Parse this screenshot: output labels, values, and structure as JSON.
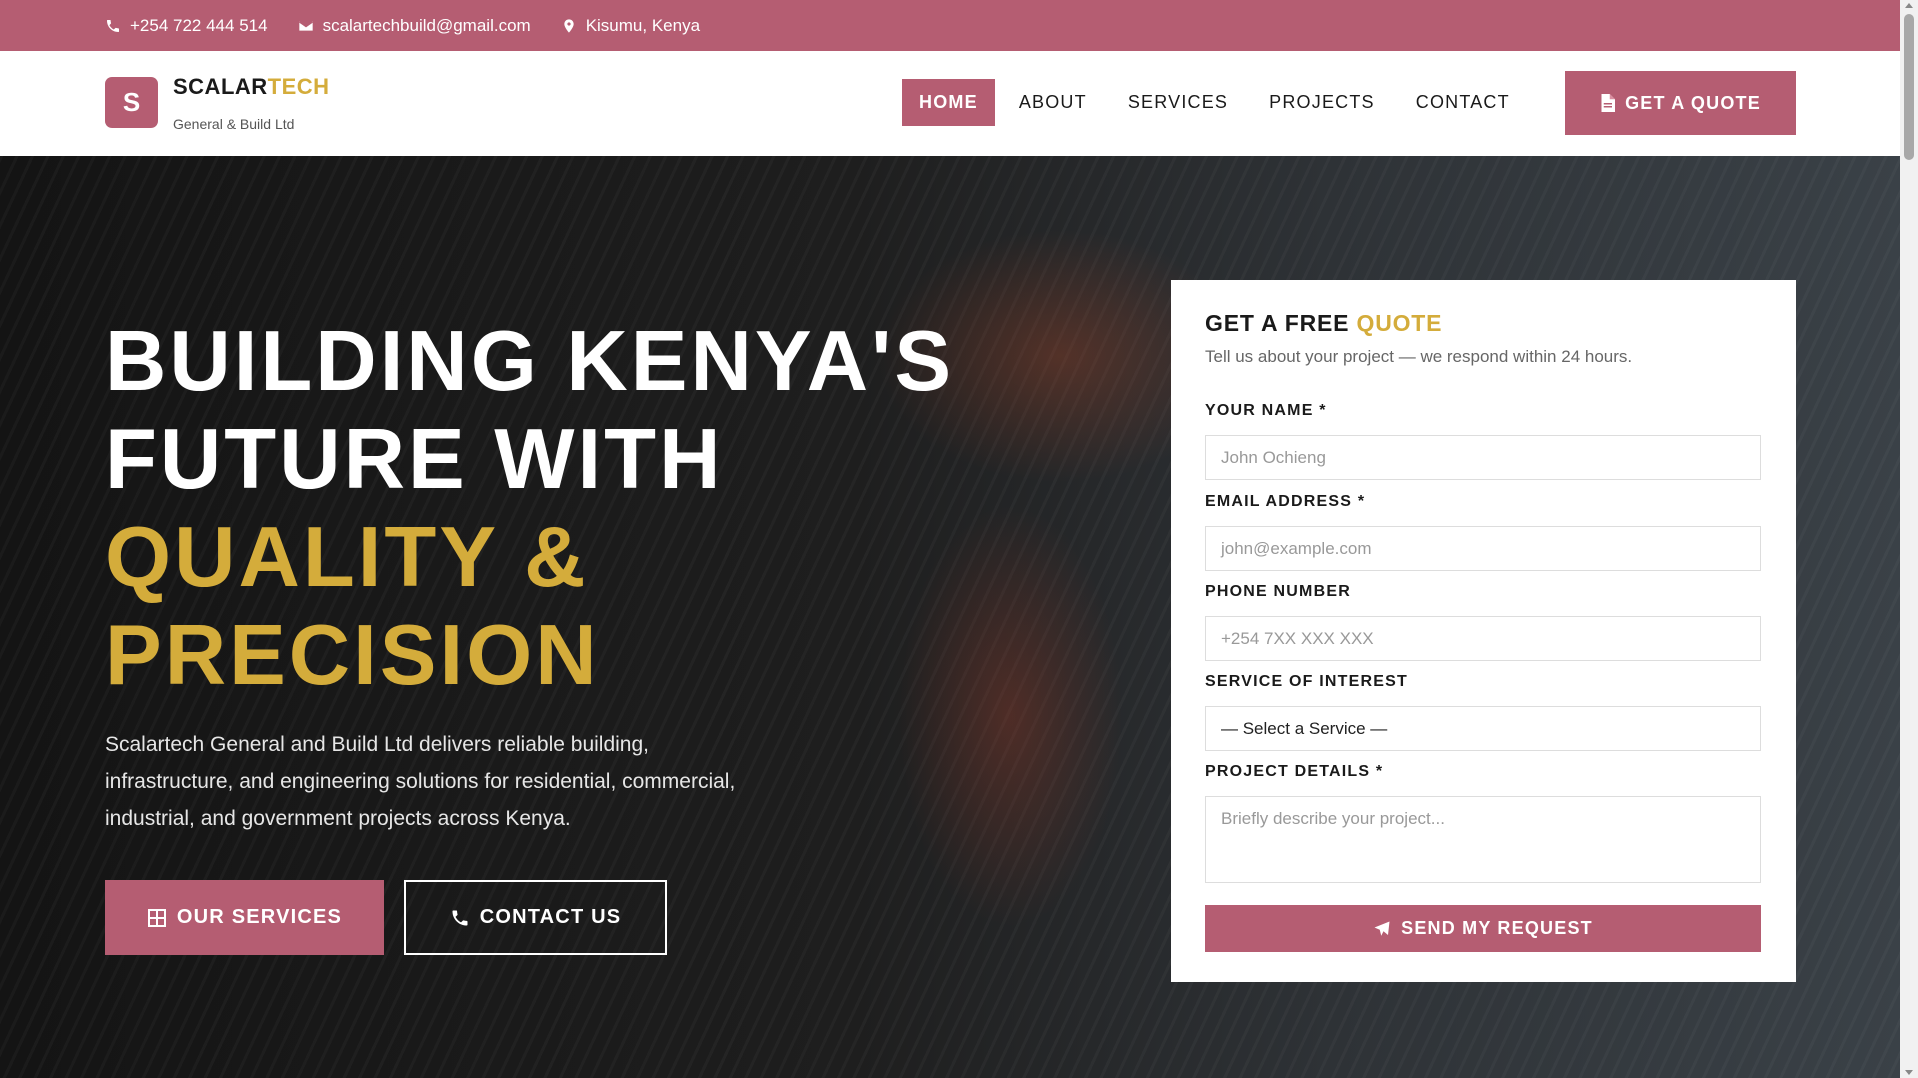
{
  "topbar": {
    "phone": "+254 722 444 514",
    "email": "scalartechbuild@gmail.com",
    "location": "Kisumu, Kenya"
  },
  "brand": {
    "logo_letter": "S",
    "name_part1": "SCALAR",
    "name_part2": "TECH",
    "tagline": "General & Build Ltd"
  },
  "nav": {
    "items": [
      {
        "label": "HOME",
        "active": true
      },
      {
        "label": "ABOUT"
      },
      {
        "label": "SERVICES"
      },
      {
        "label": "PROJECTS"
      },
      {
        "label": "CONTACT"
      }
    ],
    "quote_label": "GET A QUOTE"
  },
  "hero": {
    "title_line1": "BUILDING KENYA'S",
    "title_line2": "FUTURE WITH",
    "title_line3": "QUALITY &",
    "title_line4": "PRECISION",
    "description": "Scalartech General and Build Ltd delivers reliable building, infrastructure, and engineering solutions for residential, commercial, industrial, and government projects across Kenya.",
    "btn_services": "OUR SERVICES",
    "btn_contact": "CONTACT US"
  },
  "form": {
    "title_part1": "GET A FREE ",
    "title_part2": "QUOTE",
    "subtitle": "Tell us about your project — we respond within 24 hours.",
    "name_label": "YOUR NAME *",
    "name_placeholder": "John Ochieng",
    "email_label": "EMAIL ADDRESS *",
    "email_placeholder": "john@example.com",
    "phone_label": "PHONE NUMBER",
    "phone_placeholder": "+254 7XX XXX XXX",
    "service_label": "SERVICE OF INTEREST",
    "service_selected": "— Select a Service —",
    "details_label": "PROJECT DETAILS *",
    "details_placeholder": "Briefly describe your project...",
    "submit_label": "SEND MY REQUEST"
  },
  "colors": {
    "brand": "#b55d72",
    "accent_gold": "#d4ac3b"
  }
}
